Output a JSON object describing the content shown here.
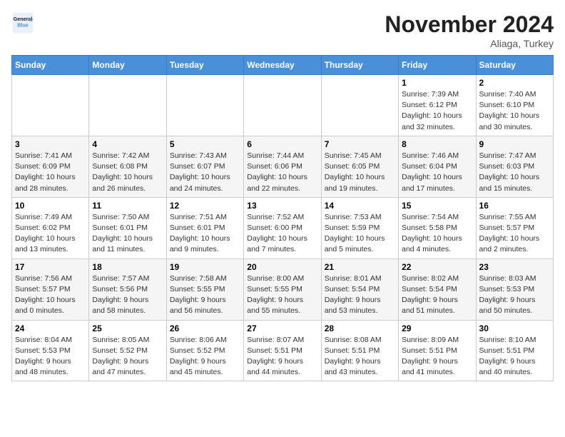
{
  "header": {
    "logo_line1": "General",
    "logo_line2": "Blue",
    "month": "November 2024",
    "location": "Aliaga, Turkey"
  },
  "weekdays": [
    "Sunday",
    "Monday",
    "Tuesday",
    "Wednesday",
    "Thursday",
    "Friday",
    "Saturday"
  ],
  "weeks": [
    [
      {
        "day": "",
        "info": ""
      },
      {
        "day": "",
        "info": ""
      },
      {
        "day": "",
        "info": ""
      },
      {
        "day": "",
        "info": ""
      },
      {
        "day": "",
        "info": ""
      },
      {
        "day": "1",
        "info": "Sunrise: 7:39 AM\nSunset: 6:12 PM\nDaylight: 10 hours\nand 32 minutes."
      },
      {
        "day": "2",
        "info": "Sunrise: 7:40 AM\nSunset: 6:10 PM\nDaylight: 10 hours\nand 30 minutes."
      }
    ],
    [
      {
        "day": "3",
        "info": "Sunrise: 7:41 AM\nSunset: 6:09 PM\nDaylight: 10 hours\nand 28 minutes."
      },
      {
        "day": "4",
        "info": "Sunrise: 7:42 AM\nSunset: 6:08 PM\nDaylight: 10 hours\nand 26 minutes."
      },
      {
        "day": "5",
        "info": "Sunrise: 7:43 AM\nSunset: 6:07 PM\nDaylight: 10 hours\nand 24 minutes."
      },
      {
        "day": "6",
        "info": "Sunrise: 7:44 AM\nSunset: 6:06 PM\nDaylight: 10 hours\nand 22 minutes."
      },
      {
        "day": "7",
        "info": "Sunrise: 7:45 AM\nSunset: 6:05 PM\nDaylight: 10 hours\nand 19 minutes."
      },
      {
        "day": "8",
        "info": "Sunrise: 7:46 AM\nSunset: 6:04 PM\nDaylight: 10 hours\nand 17 minutes."
      },
      {
        "day": "9",
        "info": "Sunrise: 7:47 AM\nSunset: 6:03 PM\nDaylight: 10 hours\nand 15 minutes."
      }
    ],
    [
      {
        "day": "10",
        "info": "Sunrise: 7:49 AM\nSunset: 6:02 PM\nDaylight: 10 hours\nand 13 minutes."
      },
      {
        "day": "11",
        "info": "Sunrise: 7:50 AM\nSunset: 6:01 PM\nDaylight: 10 hours\nand 11 minutes."
      },
      {
        "day": "12",
        "info": "Sunrise: 7:51 AM\nSunset: 6:01 PM\nDaylight: 10 hours\nand 9 minutes."
      },
      {
        "day": "13",
        "info": "Sunrise: 7:52 AM\nSunset: 6:00 PM\nDaylight: 10 hours\nand 7 minutes."
      },
      {
        "day": "14",
        "info": "Sunrise: 7:53 AM\nSunset: 5:59 PM\nDaylight: 10 hours\nand 5 minutes."
      },
      {
        "day": "15",
        "info": "Sunrise: 7:54 AM\nSunset: 5:58 PM\nDaylight: 10 hours\nand 4 minutes."
      },
      {
        "day": "16",
        "info": "Sunrise: 7:55 AM\nSunset: 5:57 PM\nDaylight: 10 hours\nand 2 minutes."
      }
    ],
    [
      {
        "day": "17",
        "info": "Sunrise: 7:56 AM\nSunset: 5:57 PM\nDaylight: 10 hours\nand 0 minutes."
      },
      {
        "day": "18",
        "info": "Sunrise: 7:57 AM\nSunset: 5:56 PM\nDaylight: 9 hours\nand 58 minutes."
      },
      {
        "day": "19",
        "info": "Sunrise: 7:58 AM\nSunset: 5:55 PM\nDaylight: 9 hours\nand 56 minutes."
      },
      {
        "day": "20",
        "info": "Sunrise: 8:00 AM\nSunset: 5:55 PM\nDaylight: 9 hours\nand 55 minutes."
      },
      {
        "day": "21",
        "info": "Sunrise: 8:01 AM\nSunset: 5:54 PM\nDaylight: 9 hours\nand 53 minutes."
      },
      {
        "day": "22",
        "info": "Sunrise: 8:02 AM\nSunset: 5:54 PM\nDaylight: 9 hours\nand 51 minutes."
      },
      {
        "day": "23",
        "info": "Sunrise: 8:03 AM\nSunset: 5:53 PM\nDaylight: 9 hours\nand 50 minutes."
      }
    ],
    [
      {
        "day": "24",
        "info": "Sunrise: 8:04 AM\nSunset: 5:53 PM\nDaylight: 9 hours\nand 48 minutes."
      },
      {
        "day": "25",
        "info": "Sunrise: 8:05 AM\nSunset: 5:52 PM\nDaylight: 9 hours\nand 47 minutes."
      },
      {
        "day": "26",
        "info": "Sunrise: 8:06 AM\nSunset: 5:52 PM\nDaylight: 9 hours\nand 45 minutes."
      },
      {
        "day": "27",
        "info": "Sunrise: 8:07 AM\nSunset: 5:51 PM\nDaylight: 9 hours\nand 44 minutes."
      },
      {
        "day": "28",
        "info": "Sunrise: 8:08 AM\nSunset: 5:51 PM\nDaylight: 9 hours\nand 43 minutes."
      },
      {
        "day": "29",
        "info": "Sunrise: 8:09 AM\nSunset: 5:51 PM\nDaylight: 9 hours\nand 41 minutes."
      },
      {
        "day": "30",
        "info": "Sunrise: 8:10 AM\nSunset: 5:51 PM\nDaylight: 9 hours\nand 40 minutes."
      }
    ]
  ]
}
